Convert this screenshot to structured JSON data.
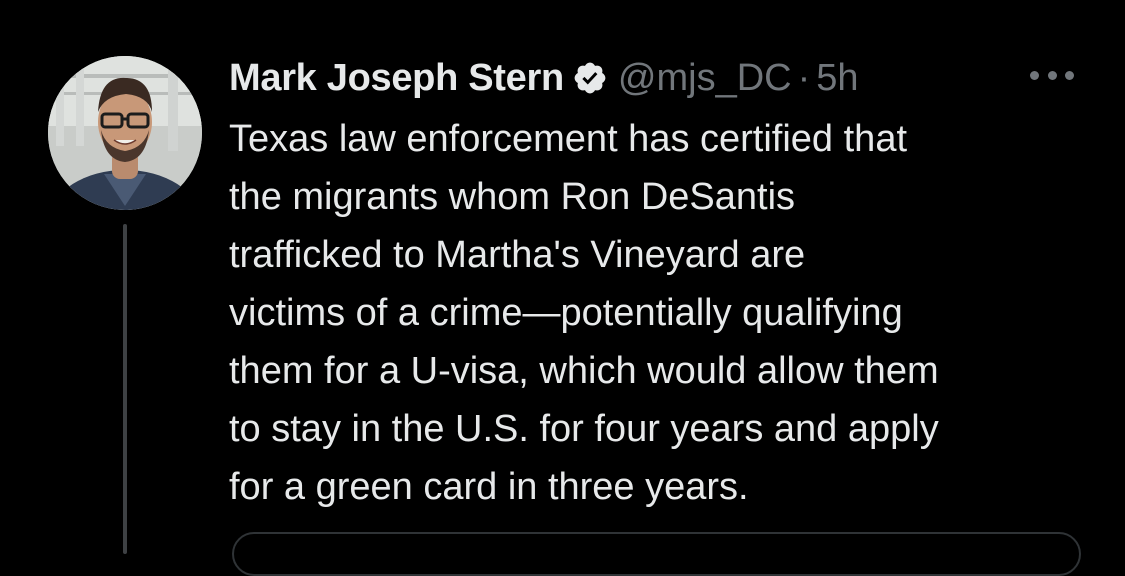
{
  "tweet": {
    "author": {
      "display_name": "Mark Joseph Stern",
      "handle": "@mjs_DC",
      "verified": true
    },
    "separator": "·",
    "timestamp": "5h",
    "text": "Texas law enforcement has certified that\nthe migrants whom Ron DeSantis\ntrafficked to Martha's Vineyard are\nvictims of a crime—potentially qualifying\nthem for a U-visa, which would allow them\nto stay in the U.S. for four years and apply\nfor a green card in three years.",
    "icons": {
      "verified": "verified-badge-icon",
      "more": "more-options-icon"
    }
  },
  "theme": {
    "background": "#000000",
    "text_primary": "#e7e9ea",
    "text_secondary": "#71767b",
    "thread_line": "#3e4144"
  }
}
